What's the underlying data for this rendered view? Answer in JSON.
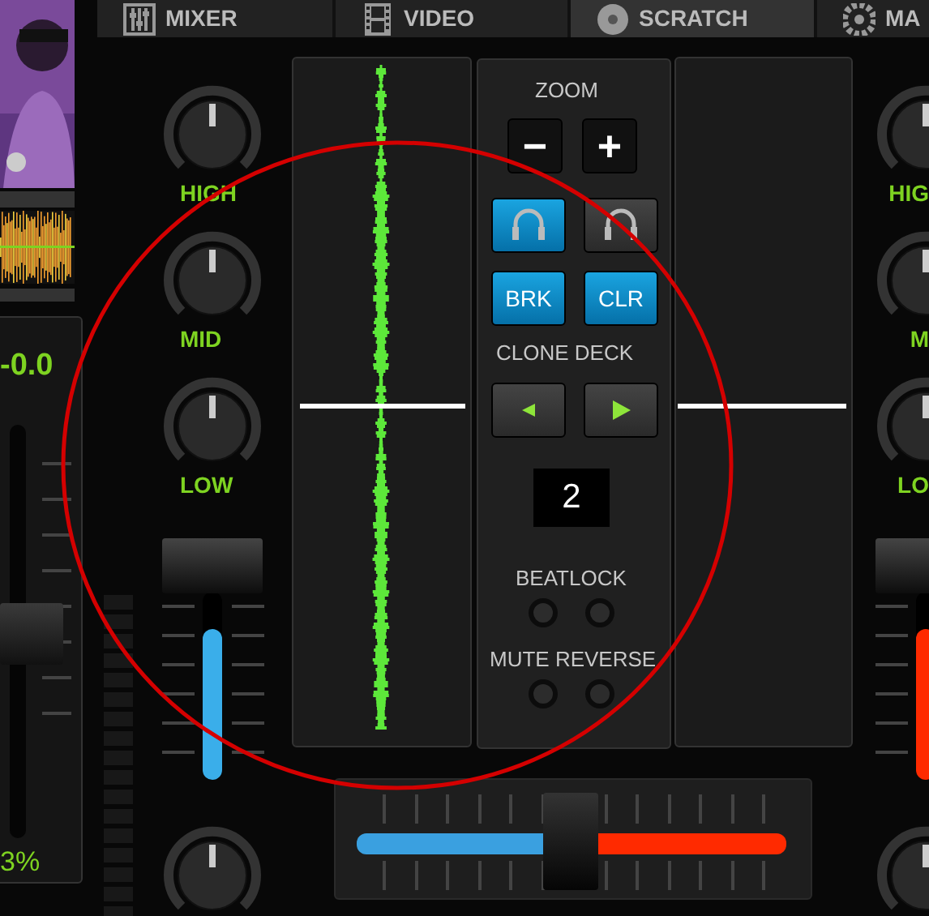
{
  "tabs": [
    {
      "label": "MIXER",
      "kind": "mixer",
      "selected": false
    },
    {
      "label": "VIDEO",
      "kind": "film",
      "selected": false
    },
    {
      "label": "SCRATCH",
      "kind": "disc",
      "selected": true
    },
    {
      "label": "MA",
      "kind": "gear",
      "selected": false
    }
  ],
  "left_deck": {
    "pitch_reading": "-0.0",
    "pitch_slider": {
      "level": 0.5
    },
    "pitch_percent": "3%"
  },
  "left_mixer": {
    "knobs": [
      {
        "label": "HIGH"
      },
      {
        "label": "MID"
      },
      {
        "label": "LOW"
      }
    ],
    "volume": {
      "level": 0.8
    }
  },
  "right_mixer": {
    "knobs": [
      {
        "label": "HIG"
      },
      {
        "label": "M"
      },
      {
        "label": "LO"
      }
    ],
    "volume": {
      "level": 0.8
    }
  },
  "center": {
    "zoom_label": "ZOOM",
    "zoom_buttons": [
      "−",
      "+"
    ],
    "headphones": [
      {
        "selected": true
      },
      {
        "selected": false
      }
    ],
    "toggles": [
      {
        "label": "BRK",
        "on": true
      },
      {
        "label": "CLR",
        "on": true
      }
    ],
    "clone_label": "CLONE DECK",
    "deck_number": "2",
    "beatlock": {
      "label": "BEATLOCK",
      "leds": [
        {
          "on": false
        },
        {
          "on": false
        }
      ]
    },
    "mute_reverse": {
      "label": "MUTE REVERSE",
      "leds": [
        {
          "on": false
        },
        {
          "on": false
        }
      ]
    }
  },
  "crossfader": {
    "level": 0.49
  }
}
